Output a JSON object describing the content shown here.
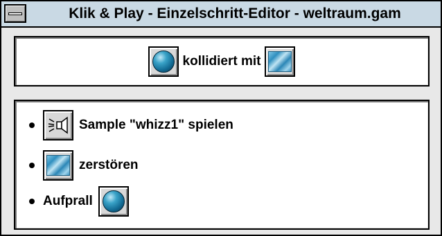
{
  "window": {
    "title": "Klik & Play - Einzelschritt-Editor - weltraum.gam"
  },
  "condition": {
    "subject_icon": "blue-ball-icon",
    "relation_label": "kollidiert mit",
    "object_icon": "blue-wall-tile-icon"
  },
  "actions": [
    {
      "icon": "speaker-icon",
      "label": "Sample \"whizz1\" spielen"
    },
    {
      "icon": "blue-wall-tile-icon",
      "label": "zerstören"
    },
    {
      "icon": "blue-ball-icon",
      "label": "Aufprall"
    }
  ],
  "colors": {
    "titlebar": "#c9d9e4",
    "window_bg": "#e8e8e8",
    "panel_bg": "#ffffff",
    "ball": "#126a93",
    "wall": "#2f8fbf"
  }
}
